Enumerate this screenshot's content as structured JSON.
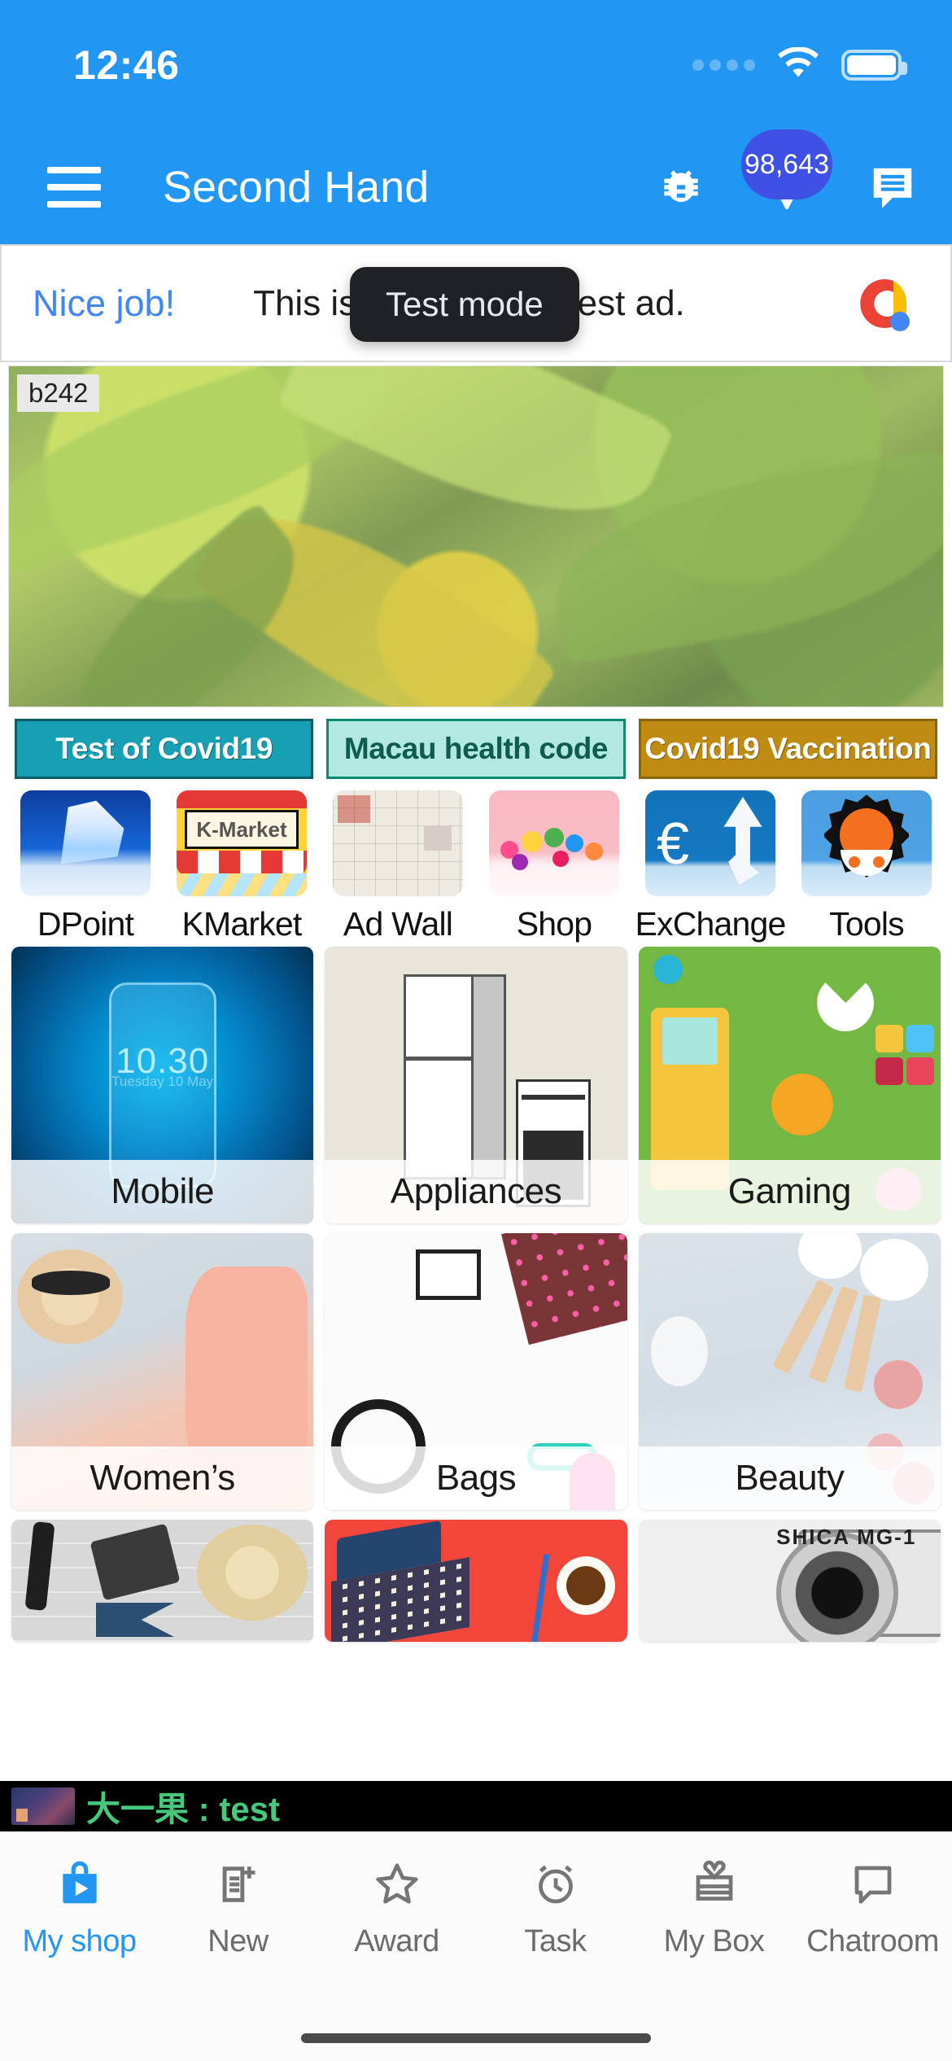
{
  "status_bar": {
    "time": "12:46",
    "signal_icon": "signal-dots-icon",
    "wifi_icon": "wifi-icon",
    "battery_icon": "battery-full-icon"
  },
  "app_bar": {
    "menu_icon": "hamburger-menu-icon",
    "title": "Second Hand",
    "actions": [
      {
        "icon": "bug-icon",
        "name": "bug-report-button"
      },
      {
        "icon": "diamond-icon",
        "name": "diamond-points-button",
        "badge": "98,643"
      },
      {
        "icon": "chat-message-icon",
        "name": "messages-button"
      }
    ]
  },
  "ad_banner": {
    "headline": "Nice job!",
    "body": "This is your AdMob test ad.",
    "body_visible_tail": "O test ad.",
    "body_visible_head": "T",
    "tooltip": "Test mode",
    "logo_icon": "admob-logo-icon"
  },
  "hero": {
    "label": "b242",
    "alt": "green leaves photo banner"
  },
  "covid_buttons": [
    {
      "label": "Test of Covid19",
      "bg": "#17a0b4",
      "fg": "#ffffff"
    },
    {
      "label": "Macau health code",
      "bg": "#b2e8e0",
      "fg": "#0e5c4e"
    },
    {
      "label": "Covid19 Vaccination",
      "bg": "#c08b12",
      "fg": "#ffffff"
    }
  ],
  "quick_icons": [
    {
      "label": "DPoint",
      "icon": "diamond-app-icon"
    },
    {
      "label": "KMarket",
      "icon": "kmarket-storefront-icon",
      "sign_text": "K-Market"
    },
    {
      "label": "Ad Wall",
      "icon": "ad-wall-icon"
    },
    {
      "label": "Shop",
      "icon": "flower-shop-icon"
    },
    {
      "label": "ExChange",
      "icon": "euro-exchange-icon",
      "symbol": "€"
    },
    {
      "label": "Tools",
      "icon": "gear-tools-icon"
    }
  ],
  "categories": [
    {
      "label": "Mobile",
      "icon": "mobile-phone-photo",
      "overlay_time": "10.30",
      "overlay_date": "Tuesday 10 May"
    },
    {
      "label": "Appliances",
      "icon": "appliances-photo"
    },
    {
      "label": "Gaming",
      "icon": "gaming-photo"
    },
    {
      "label": "Women’s",
      "icon": "womens-fashion-photo"
    },
    {
      "label": "Bags",
      "icon": "bags-photo"
    },
    {
      "label": "Beauty",
      "icon": "beauty-photo"
    },
    {
      "label": "",
      "icon": "mens-accessories-photo"
    },
    {
      "label": "",
      "icon": "laptop-desk-photo"
    },
    {
      "label": "",
      "icon": "camera-photo",
      "camera_text": "SHICA MG-1"
    }
  ],
  "ticker": {
    "avatar": "user-thumbnail",
    "message": "大一果 : test"
  },
  "bottom_nav": {
    "active_index": 0,
    "items": [
      {
        "label": "My shop",
        "icon": "shopping-bag-play-icon"
      },
      {
        "label": "New",
        "icon": "new-document-icon"
      },
      {
        "label": "Award",
        "icon": "star-outline-icon"
      },
      {
        "label": "Task",
        "icon": "alarm-clock-icon"
      },
      {
        "label": "My Box",
        "icon": "gift-box-icon"
      },
      {
        "label": "Chatroom",
        "icon": "chat-bubble-icon"
      }
    ]
  },
  "colors": {
    "brand_blue": "#2196f3",
    "accent_blue": "#4285f4",
    "ticker_green": "#46c97c",
    "badge_blue": "#3f51e5"
  }
}
